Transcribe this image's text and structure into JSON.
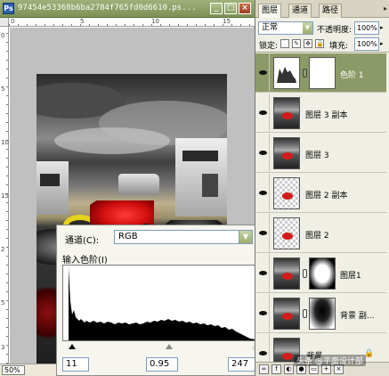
{
  "document": {
    "title": "97454e53368b6ba2784f765fd0d6610.ps...",
    "zoom": "50%",
    "ruler_top_marks": [
      "0",
      "5",
      "10",
      "15"
    ],
    "ruler_left_marks": [
      "0",
      "5",
      "10",
      "15",
      "2",
      "5",
      "3"
    ]
  },
  "levels_dialog": {
    "channel_label": "通道(C):",
    "channel_value": "RGB",
    "input_levels_label": "输入色阶(I)",
    "input_black": "11",
    "input_gamma": "0.95",
    "input_white": "247",
    "histogram_color": "#000000"
  },
  "layers_panel": {
    "tabs": [
      "图层",
      "通道",
      "路径"
    ],
    "blend_mode": "正常",
    "opacity_label": "不透明度:",
    "opacity_value": "100%",
    "lock_label": "锁定:",
    "fill_label": "填充:",
    "fill_value": "100%",
    "layers": [
      {
        "name": "色阶 1",
        "thumb": "levels",
        "selected": true,
        "visible": true
      },
      {
        "name": "图层 3 副本",
        "thumb": "photo",
        "selected": false,
        "visible": true
      },
      {
        "name": "图层 3",
        "thumb": "photo",
        "selected": false,
        "visible": true
      },
      {
        "name": "图层 2 副本",
        "thumb": "checker",
        "selected": false,
        "visible": true
      },
      {
        "name": "图层 2",
        "thumb": "checker",
        "selected": false,
        "visible": true
      },
      {
        "name": "图层1",
        "thumb": "photo-mask",
        "selected": false,
        "visible": true
      },
      {
        "name": "背景 副...",
        "thumb": "photo-mask2",
        "selected": false,
        "visible": true
      },
      {
        "name": "背景",
        "thumb": "photo",
        "selected": false,
        "visible": true
      }
    ]
  },
  "watermark": "头条 @平面设计部",
  "colors": {
    "title_bar": "#7e9156",
    "selected_layer": "#8c9a67",
    "canvas_bg": "#c0c0c0"
  }
}
